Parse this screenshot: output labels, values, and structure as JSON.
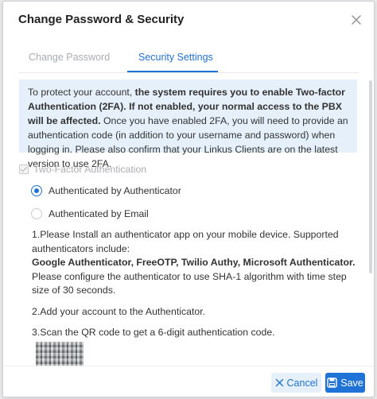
{
  "dialog": {
    "title": "Change Password & Security",
    "close_icon": "close-icon"
  },
  "tabs": [
    {
      "label": "Change Password",
      "active": false
    },
    {
      "label": "Security Settings",
      "active": true
    }
  ],
  "notice": {
    "p1": "To protect your account, ",
    "p1_bold": "the system requires you to enable Two-factor Authentication (2FA). If not enabled, your normal access to the PBX will be affected.",
    "p2": " Once you have enabled 2FA, you will need to provide an authentication code (in addition to your username and password) when logging in. Please also confirm that your Linkus Clients are on the latest version to use 2FA."
  },
  "two_factor": {
    "label": "Two-Factor Authentication",
    "checked": true,
    "disabled": true
  },
  "methods": [
    {
      "label": "Authenticated by Authenticator",
      "selected": true
    },
    {
      "label": "Authenticated by Email",
      "selected": false
    }
  ],
  "steps": {
    "step1_a": "1.Please Install an authenticator app on your mobile device. Supported authenticators include:",
    "step1_bold": "Google Authenticator, FreeOTP, Twilio Authy, Microsoft Authenticator.",
    "step1_b": " Please configure the authenticator to use SHA-1 algorithm with time step size of 30 seconds.",
    "step2": "2.Add your account to the Authenticator.",
    "step3": "3.Scan the QR code to get a 6-digit authentication code."
  },
  "footer": {
    "cancel_label": "Cancel",
    "save_label": "Save"
  },
  "colors": {
    "accent": "#1f72d6",
    "notice_bg": "#e6f0fa"
  }
}
